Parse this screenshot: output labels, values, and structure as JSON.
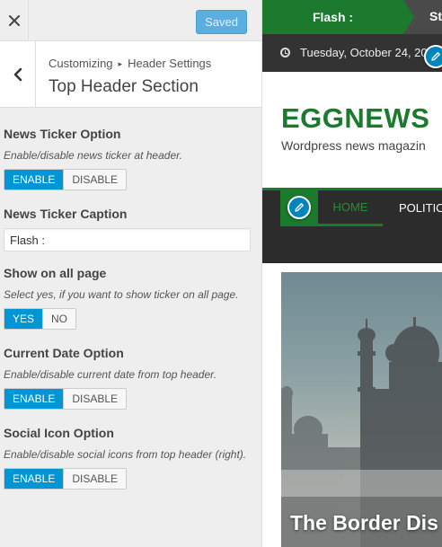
{
  "header": {
    "close_icon": "close-icon",
    "save_label": "Saved"
  },
  "section": {
    "back_icon": "chevron-left-icon",
    "breadcrumb_root": "Customizing",
    "breadcrumb_separator": "▸",
    "breadcrumb_parent": "Header Settings",
    "title": "Top Header Section"
  },
  "controls": {
    "news_ticker": {
      "title": "News Ticker Option",
      "description": "Enable/disable news ticker at header.",
      "options": [
        "ENABLE",
        "DISABLE"
      ],
      "selected": "ENABLE"
    },
    "ticker_caption": {
      "title": "News Ticker Caption",
      "value": "Flash :"
    },
    "show_all_page": {
      "title": "Show on all page",
      "description": "Select yes, if you want to show ticker on all page.",
      "options": [
        "YES",
        "NO"
      ],
      "selected": "YES"
    },
    "current_date": {
      "title": "Current Date Option",
      "description": "Enable/disable current date from top header.",
      "options": [
        "ENABLE",
        "DISABLE"
      ],
      "selected": "ENABLE"
    },
    "social_icon": {
      "title": "Social Icon Option",
      "description": "Enable/disable social icons from top header (right).",
      "options": [
        "ENABLE",
        "DISABLE"
      ],
      "selected": "ENABLE"
    }
  },
  "preview": {
    "ticker_caption": "Flash :",
    "ticker_text": "St",
    "date": "Tuesday, October 24, 20",
    "site_title": "EGGNEWS",
    "tagline": "Wordpress news magazin",
    "nav": [
      "HOME",
      "POLITIC"
    ],
    "hero_title": "The Border Dis",
    "colors": {
      "accent_green": "#1b7a2e",
      "customizer_blue": "#0096d6",
      "edit_shortcut": "#0085ba",
      "dark_bar": "#333333"
    }
  }
}
